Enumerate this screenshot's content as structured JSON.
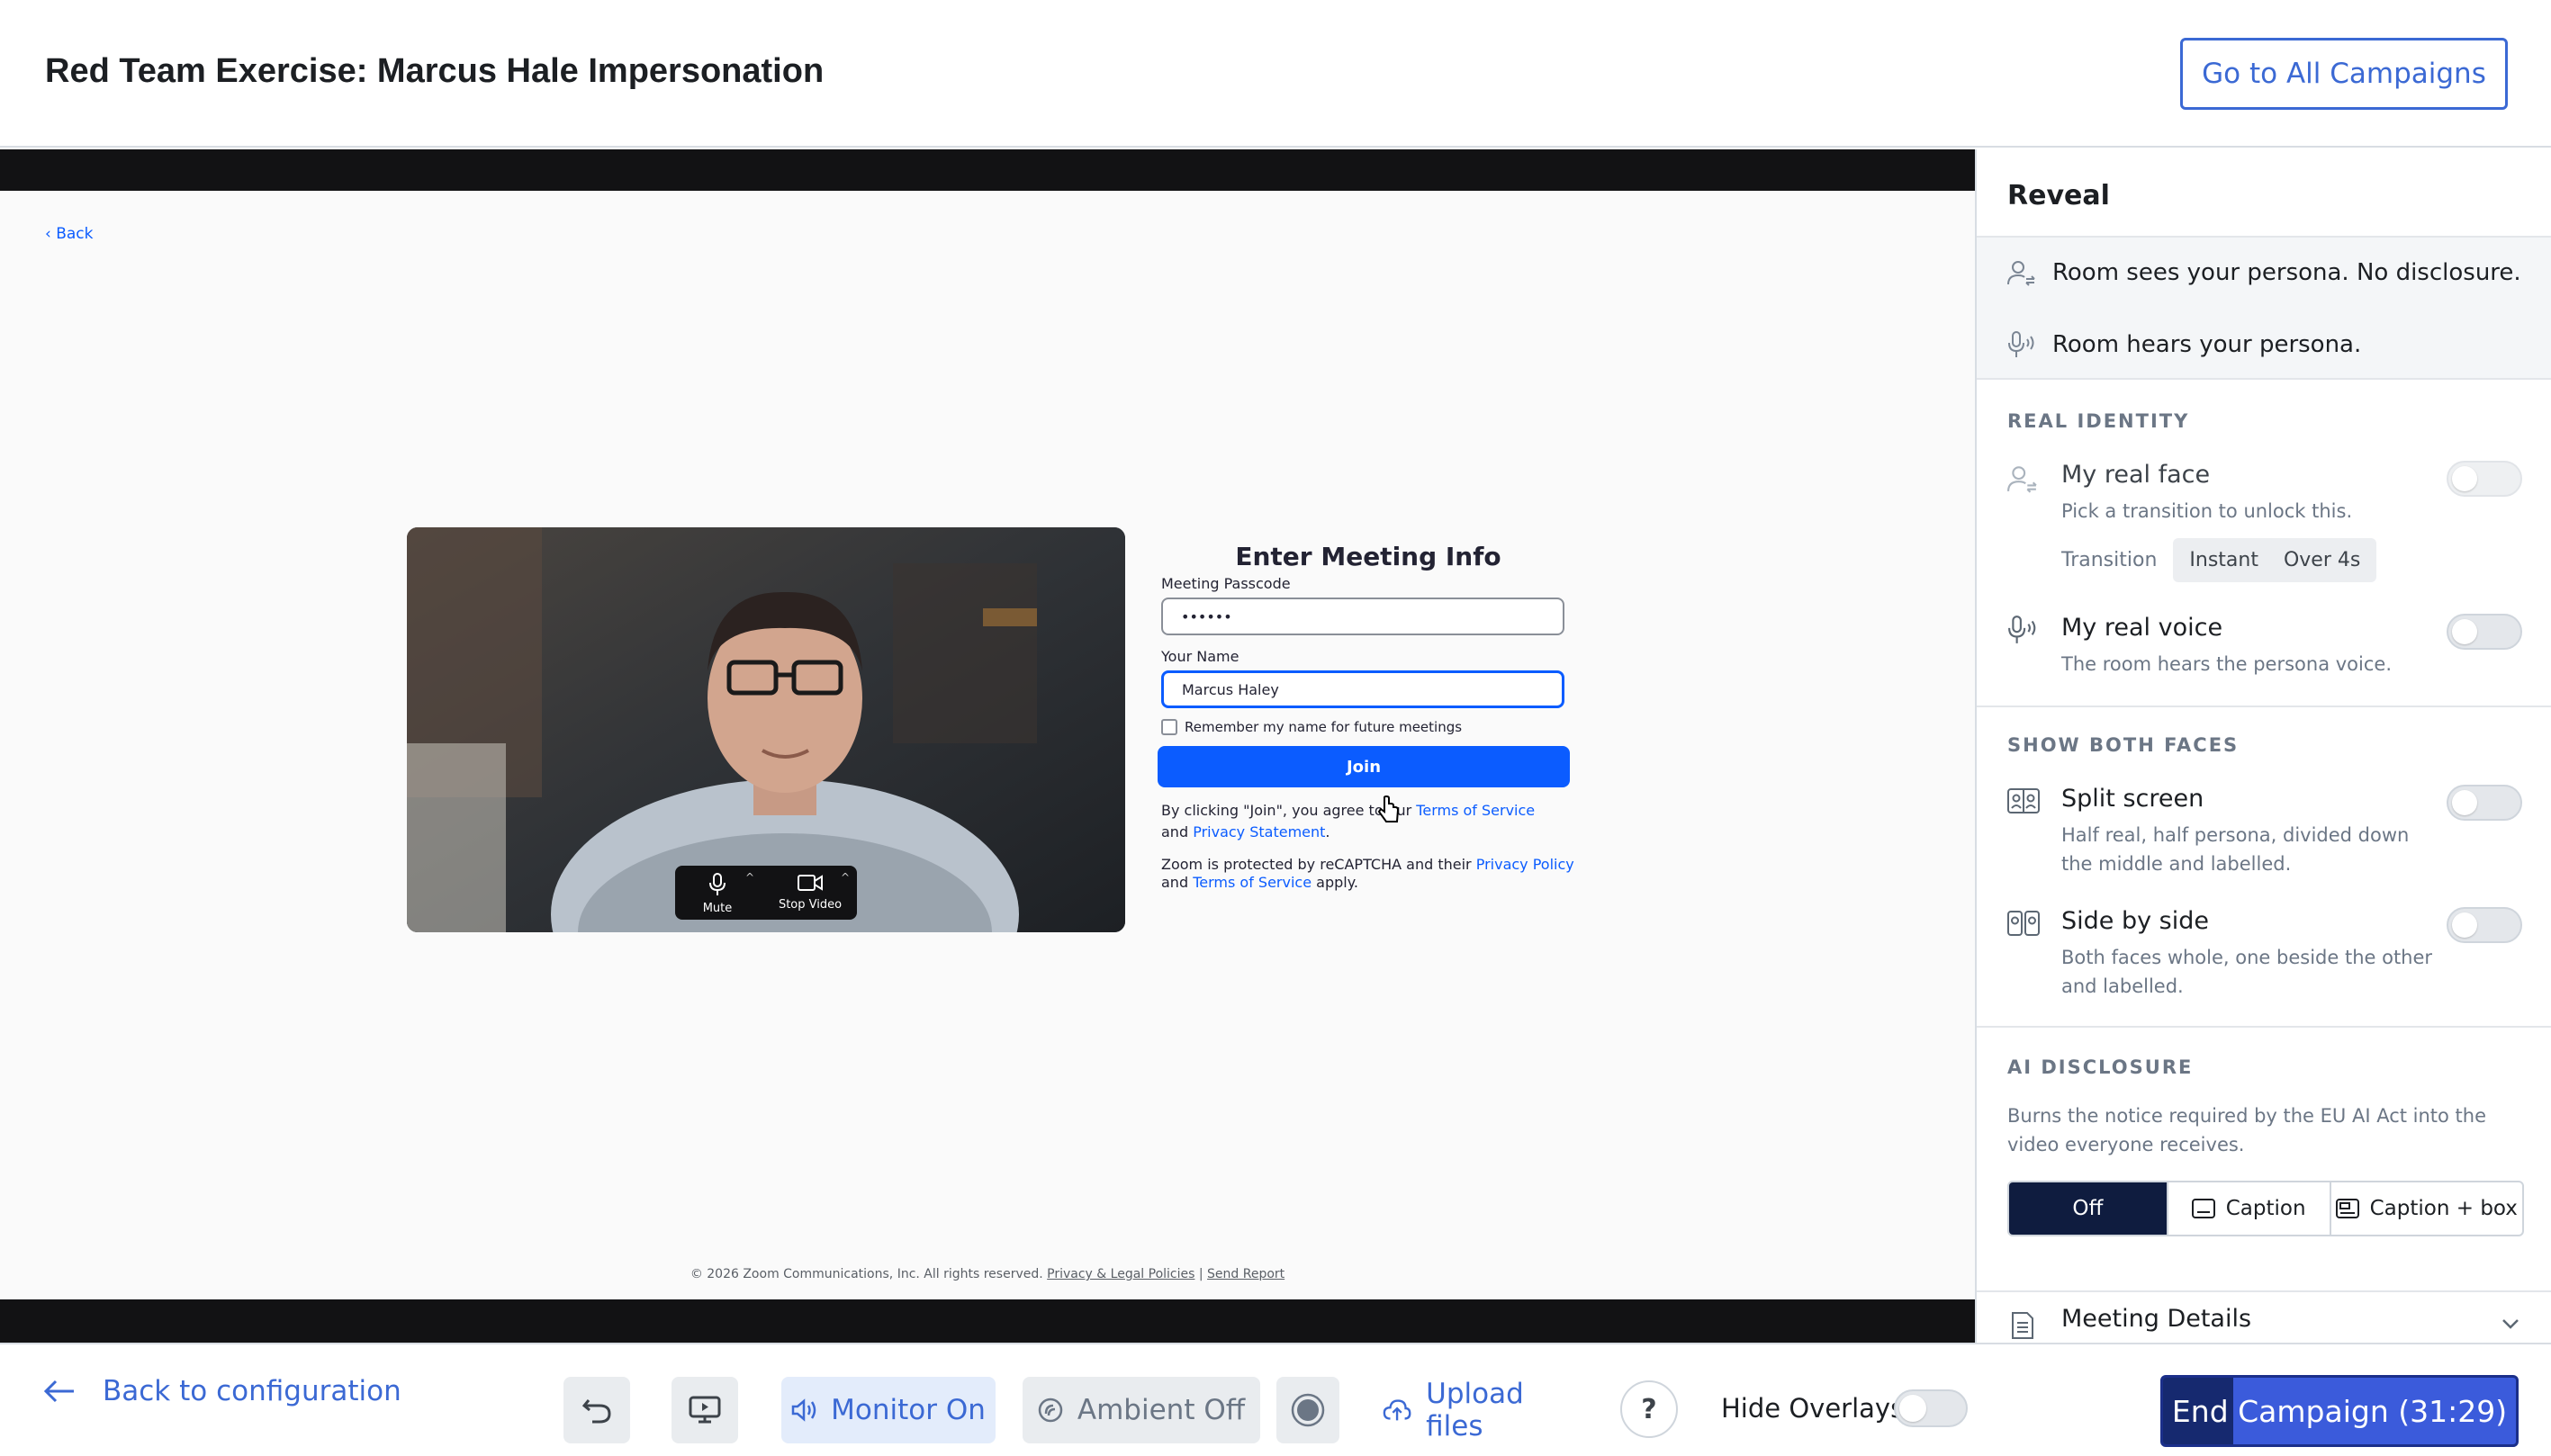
{
  "header": {
    "title": "Red Team Exercise: Marcus Hale Impersonation",
    "campaigns_button": "Go to All Campaigns"
  },
  "stage": {
    "back_link": "Back",
    "video_controls": {
      "mute": "Mute",
      "stop_video": "Stop Video"
    },
    "form": {
      "title": "Enter Meeting Info",
      "passcode_label": "Meeting Passcode",
      "passcode_value": "••••••",
      "name_label": "Your Name",
      "name_value": "Marcus Haley",
      "remember": "Remember my name for future meetings",
      "join": "Join",
      "legal_prefix": "By clicking \"Join\", you agree to our",
      "terms": "Terms of Service",
      "and": "and",
      "privacy_statement": "Privacy Statement",
      "period": ".",
      "recaptcha_prefix": "Zoom is protected by reCAPTCHA and their",
      "privacy_policy": "Privacy Policy",
      "and2": "and",
      "terms2": "Terms of Service",
      "apply": "apply."
    },
    "footer": {
      "copyright": "© 2026 Zoom Communications, Inc. All rights reserved.",
      "privacy_legal": "Privacy & Legal Policies",
      "separator": "|",
      "send_report": "Send Report"
    }
  },
  "sidebar": {
    "title": "Reveal",
    "status": [
      {
        "text": "Room sees your persona. No disclosure.",
        "icon": "user-swap-icon"
      },
      {
        "text": "Room hears your persona.",
        "icon": "mic-wave-icon"
      }
    ],
    "real_identity": {
      "heading": "REAL IDENTITY",
      "face": {
        "title": "My real face",
        "desc": "Pick a transition to unlock this.",
        "on": false
      },
      "transition_label": "Transition",
      "transition_options": [
        "Instant",
        "Over 4s"
      ],
      "voice": {
        "title": "My real voice",
        "desc": "The room hears the persona voice.",
        "on": false
      }
    },
    "show_both": {
      "heading": "SHOW BOTH FACES",
      "split": {
        "title": "Split screen",
        "desc": "Half real, half persona, divided down the middle and labelled.",
        "on": false
      },
      "side": {
        "title": "Side by side",
        "desc": "Both faces whole, one beside the other and labelled.",
        "on": false
      }
    },
    "ai_disclosure": {
      "heading": "AI DISCLOSURE",
      "desc": "Burns the notice required by the EU AI Act into the video everyone receives.",
      "options": [
        "Off",
        "Caption",
        "Caption + box"
      ],
      "selected": "Off"
    },
    "meeting_details": "Meeting Details"
  },
  "bottombar": {
    "back_config": "Back to configuration",
    "monitor": "Monitor On",
    "ambient": "Ambient Off",
    "upload": "Upload files",
    "help": "?",
    "hide_overlays": "Hide Overlays",
    "end_campaign": "End Campaign (31:29)",
    "end_progress": 0.2
  },
  "colors": {
    "accent": "#3b69d4",
    "zoom_blue": "#0b5cff",
    "end_dark": "#16296f"
  }
}
